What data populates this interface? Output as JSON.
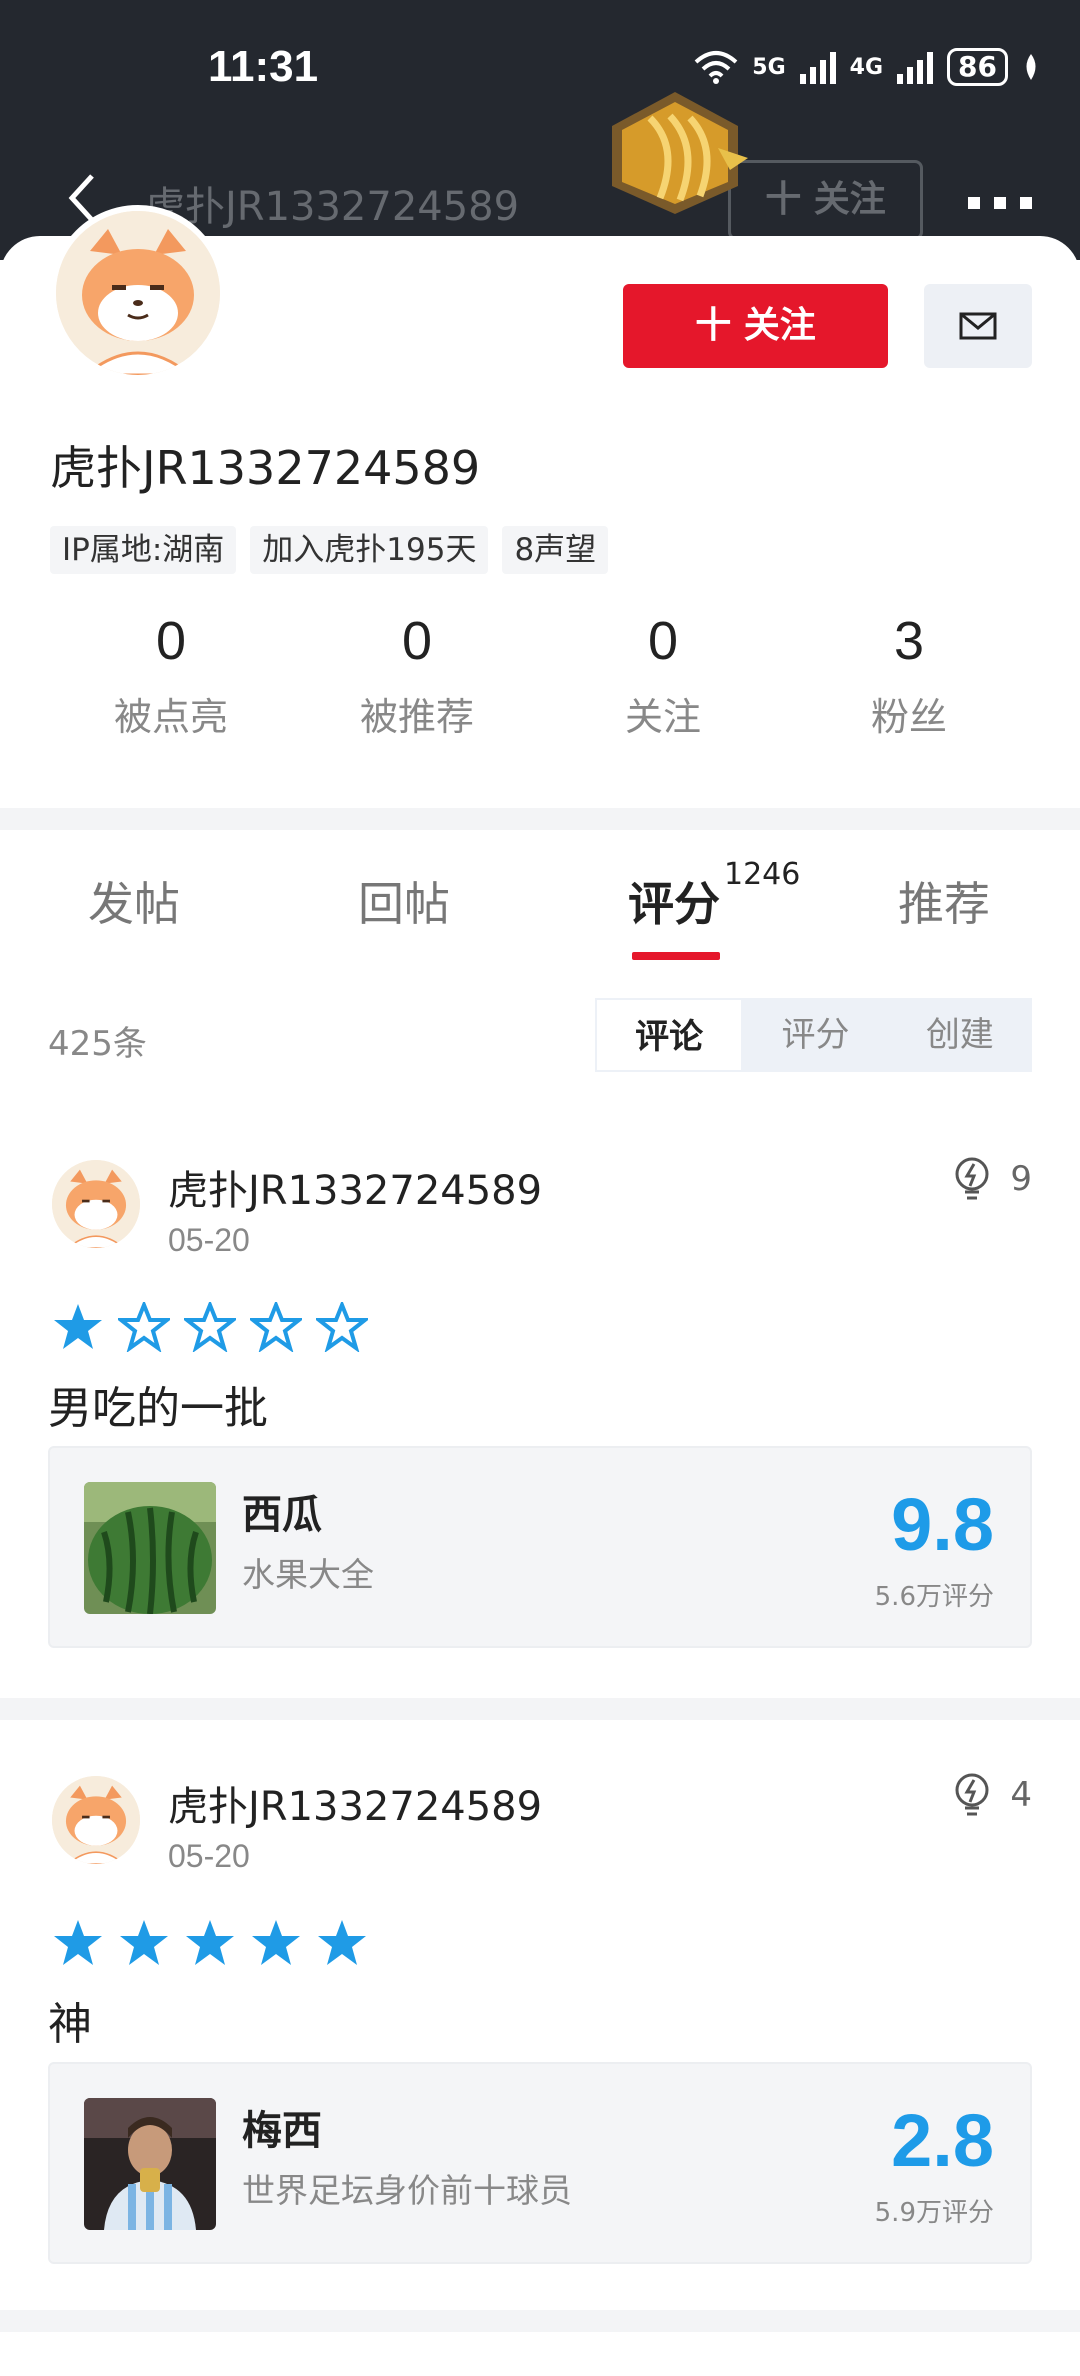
{
  "status_bar": {
    "time": "11:31",
    "net1": "5G",
    "net2": "4G",
    "battery": "86"
  },
  "navbar": {
    "title": "虎扑JR1332724589",
    "follow_label": "十 关注"
  },
  "profile": {
    "username": "虎扑JR1332724589",
    "follow_button": "十 关注",
    "tags": [
      "IP属地:湖南",
      "加入虎扑195天",
      "8声望"
    ],
    "stats": [
      {
        "value": "0",
        "label": "被点亮"
      },
      {
        "value": "0",
        "label": "被推荐"
      },
      {
        "value": "0",
        "label": "关注"
      },
      {
        "value": "3",
        "label": "粉丝"
      }
    ]
  },
  "tabs": [
    {
      "label": "发帖",
      "active": false
    },
    {
      "label": "回帖",
      "active": false
    },
    {
      "label": "评分",
      "active": true,
      "count": "1246"
    },
    {
      "label": "推荐",
      "active": false
    }
  ],
  "filter": {
    "count": "425条",
    "segments": [
      "评论",
      "评分",
      "创建"
    ],
    "selected": "评论"
  },
  "reviews": [
    {
      "name": "虎扑JR1332724589",
      "date": "05-20",
      "likes": "9",
      "stars": 1,
      "text": "男吃的一批",
      "item": {
        "title": "西瓜",
        "subtitle": "水果大全",
        "score": "9.8",
        "score_count": "5.6万评分"
      }
    },
    {
      "name": "虎扑JR1332724589",
      "date": "05-20",
      "likes": "4",
      "stars": 5,
      "text": "神",
      "item": {
        "title": "梅西",
        "subtitle": "世界足坛身价前十球员",
        "score": "2.8",
        "score_count": "5.9万评分"
      }
    }
  ],
  "colors": {
    "accent_red": "#e5172b",
    "score_blue": "#1e9be8",
    "star_blue": "#1f9be6",
    "header_dark": "#24282f"
  }
}
